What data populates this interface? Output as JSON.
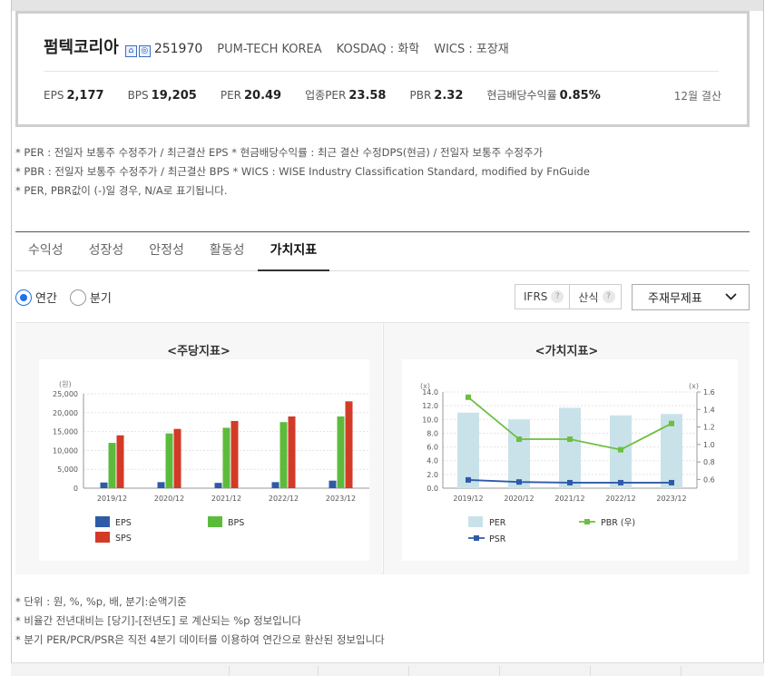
{
  "company": {
    "name": "펌텍코리아",
    "icons": [
      "home-icon",
      "ir-icon"
    ],
    "code": "251970",
    "english_name": "PUM-TECH KOREA",
    "market": "KOSDAQ : 화학",
    "wics": "WICS : 포장재",
    "settlement": "12월 결산",
    "stats": [
      {
        "label": "EPS",
        "value": "2,177"
      },
      {
        "label": "BPS",
        "value": "19,205"
      },
      {
        "label": "PER",
        "value": "20.49"
      },
      {
        "label": "업종PER",
        "value": "23.58"
      },
      {
        "label": "PBR",
        "value": "2.32"
      },
      {
        "label": "현금배당수익률",
        "value": "0.85%"
      }
    ]
  },
  "notes_top": [
    "* PER : 전일자 보통주 수정주가 / 최근결산 EPS * 현금배당수익률 : 최근 결산 수정DPS(현금) / 전일자 보통주 수정주가",
    "* PBR : 전일자 보통주 수정주가 / 최근결산 BPS * WICS : WISE Industry Classification Standard, modified by FnGuide",
    "* PER, PBR값이 (-)일 경우, N/A로 표기됩니다."
  ],
  "tabs": [
    "수익성",
    "성장성",
    "안정성",
    "활동성",
    "가치지표"
  ],
  "active_tab": 4,
  "period": {
    "annual": "연간",
    "quarter": "분기",
    "selected": "annual"
  },
  "options": {
    "ifrs": "IFRS",
    "formula": "산식",
    "help": "?"
  },
  "statement_select": "주재무제표",
  "colors": {
    "eps": "#2e5aa8",
    "bps": "#5dbb3c",
    "sps": "#d33a27",
    "per": "#c9e2ea",
    "pbr": "#6cbf3e",
    "psr": "#2e5aa8"
  },
  "chart_data": [
    {
      "type": "bar",
      "title": "<주당지표>",
      "ylabel": "(원)",
      "categories": [
        "2019/12",
        "2020/12",
        "2021/12",
        "2022/12",
        "2023/12"
      ],
      "ylim": [
        0,
        25000
      ],
      "yticks": [
        "0",
        "5,000",
        "10,000",
        "15,000",
        "20,000",
        "25,000"
      ],
      "series": [
        {
          "name": "EPS",
          "values": [
            1500,
            1600,
            1400,
            1600,
            2000
          ]
        },
        {
          "name": "BPS",
          "values": [
            12000,
            14500,
            16000,
            17500,
            19000
          ]
        },
        {
          "name": "SPS",
          "values": [
            14000,
            15700,
            17800,
            19000,
            23000
          ]
        }
      ],
      "legend": "bottom"
    },
    {
      "type": "bar",
      "title": "<가치지표>",
      "ylabel": "(x)",
      "y2label": "(x)",
      "categories": [
        "2019/12",
        "2020/12",
        "2021/12",
        "2022/12",
        "2023/12"
      ],
      "ylim": [
        0,
        14
      ],
      "yticks": [
        "0.0",
        "2.0",
        "4.0",
        "6.0",
        "8.0",
        "10.0",
        "12.0",
        "14.0"
      ],
      "y2lim": [
        0.5,
        1.6
      ],
      "y2ticks": [
        "0.6",
        "0.8",
        "1.0",
        "1.2",
        "1.4",
        "1.6"
      ],
      "series": [
        {
          "name": "PER",
          "type": "bar",
          "axis": "left",
          "values": [
            11.0,
            10.0,
            11.7,
            10.6,
            10.8
          ]
        },
        {
          "name": "PBR (우)",
          "type": "line",
          "axis": "right",
          "values": [
            1.54,
            1.06,
            1.06,
            0.94,
            1.24
          ]
        },
        {
          "name": "PSR",
          "type": "line",
          "axis": "left",
          "values": [
            1.2,
            0.9,
            0.8,
            0.8,
            0.8
          ]
        }
      ],
      "legend": "bottom"
    }
  ],
  "notes_bottom": [
    "* 단위 : 원, %, %p, 배, 분기:순액기준",
    "* 비율간 전년대비는 [당기]-[전년도] 로 계산되는 %p 정보입니다",
    "* 분기 PER/PCR/PSR은 직전 4분기 데이터를 이용하여 연간으로 환산된 정보입니다"
  ]
}
